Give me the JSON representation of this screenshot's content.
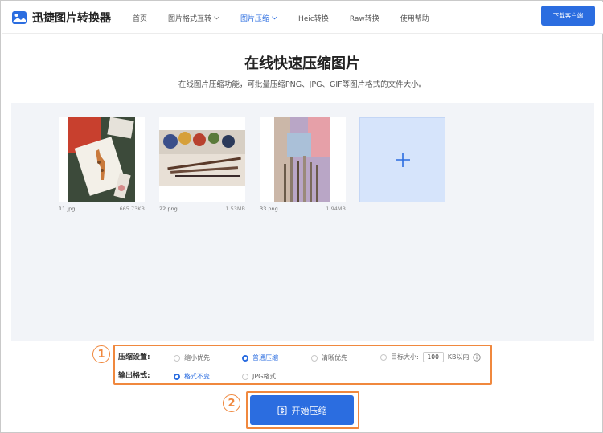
{
  "header": {
    "app_name": "迅捷图片转换器",
    "logo_icon": "picture-icon",
    "nav": [
      {
        "label": "首页"
      },
      {
        "label": "图片格式互转",
        "has_dropdown": true
      },
      {
        "label": "图片压缩",
        "has_dropdown": true,
        "active": true
      },
      {
        "label": "Heic转换"
      },
      {
        "label": "Raw转换"
      },
      {
        "label": "使用帮助"
      }
    ],
    "download_label": "下载客户端"
  },
  "main": {
    "title": "在线快速压缩图片",
    "subtitle": "在线图片压缩功能，可批量压缩PNG、JPG、GIF等图片格式的文件大小。"
  },
  "files": [
    {
      "name": "11.jpg",
      "size": "665.73KB"
    },
    {
      "name": "22.png",
      "size": "1.53MB"
    },
    {
      "name": "33.png",
      "size": "1.94MB"
    }
  ],
  "add_icon": "plus-icon",
  "annotations": {
    "step1": "1",
    "step2": "2"
  },
  "settings": {
    "compress_label": "压缩设置:",
    "compress_options": [
      {
        "label": "缩小优先",
        "selected": false
      },
      {
        "label": "普通压缩",
        "selected": true
      },
      {
        "label": "清晰优先",
        "selected": false
      },
      {
        "label": "目标大小:",
        "selected": false
      }
    ],
    "target_value": "100",
    "target_unit": "KB以内",
    "output_label": "输出格式:",
    "output_options": [
      {
        "label": "格式不变",
        "selected": true
      },
      {
        "label": "JPG格式",
        "selected": false
      }
    ]
  },
  "start_button": {
    "label": "开始压缩",
    "icon": "compress-icon"
  },
  "colors": {
    "accent": "#2b6de0",
    "highlight": "#f0883e",
    "upload_bg": "#f2f4f8"
  }
}
